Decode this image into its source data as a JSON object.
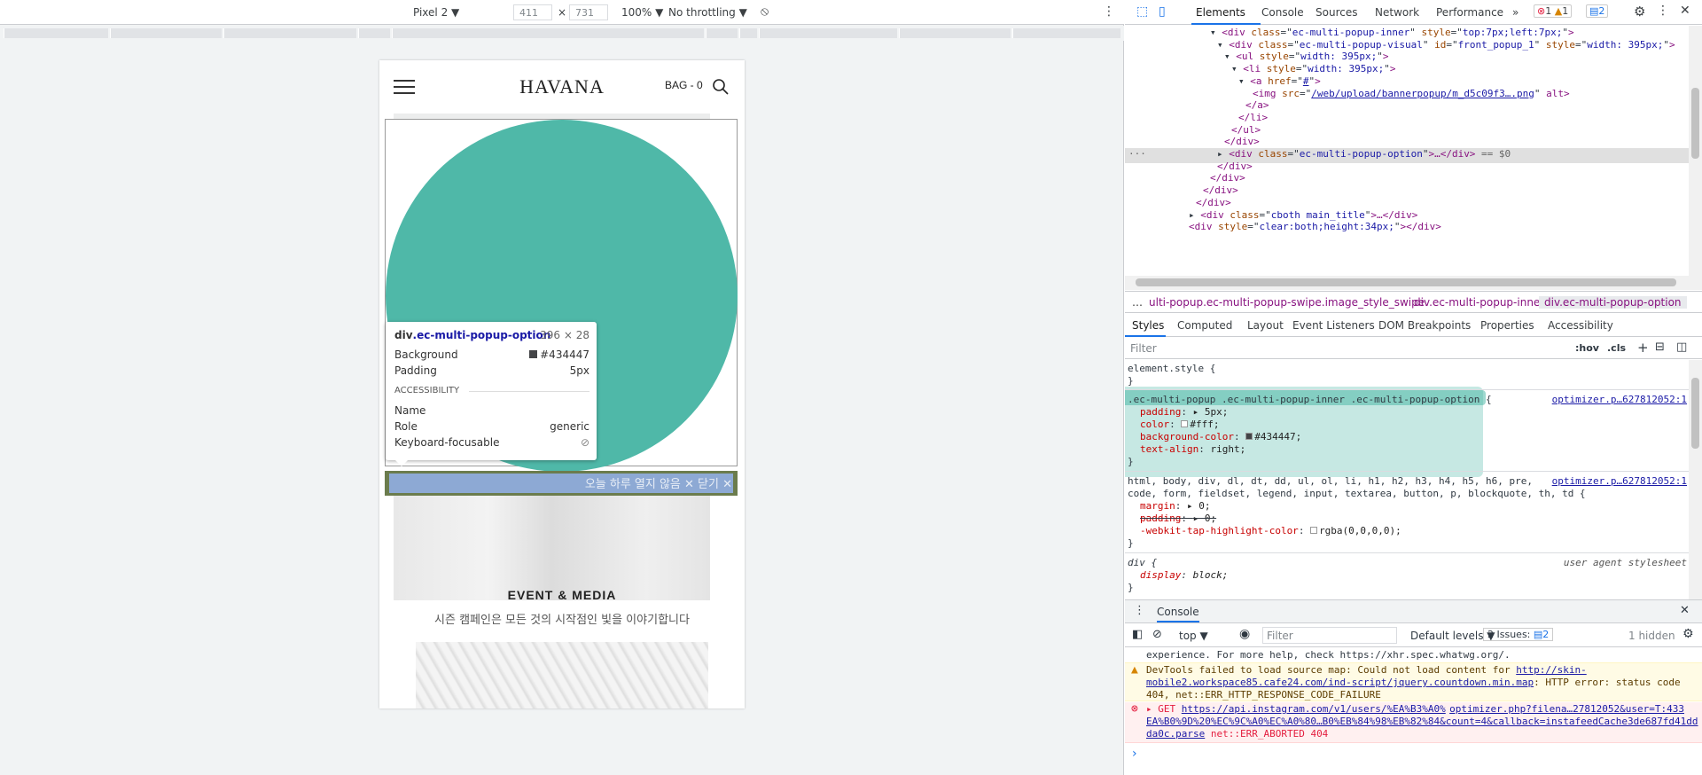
{
  "device_toolbar": {
    "device": "Pixel 2 ▼",
    "width": "411",
    "times": "×",
    "height": "731",
    "zoom": "100% ▼",
    "throttle": "No throttling ▼"
  },
  "site": {
    "logo": "HAVANA",
    "bag": "BAG - 0",
    "popup_option_text": "오늘 하루 열지 않음 ✕ 닫기 ✕",
    "event_title": "EVENT & MEDIA",
    "event_subtitle": "시즌 캠페인은 모든 것의 시작점인 빛을 이야기합니다",
    "popup_circle_color": "#4fb8a8"
  },
  "tooltip": {
    "element_tag": "div",
    "element_class": ".ec-multi-popup-option",
    "size": "396 × 28",
    "background_label": "Background",
    "background_value": "#434447",
    "padding_label": "Padding",
    "padding_value": "5px",
    "section": "ACCESSIBILITY",
    "name_label": "Name",
    "role_label": "Role",
    "role_value": "generic",
    "focus_label": "Keyboard-focusable"
  },
  "devtools": {
    "tabs": [
      "Elements",
      "Console",
      "Sources",
      "Network",
      "Performance",
      "»"
    ],
    "errors": "1",
    "warnings": "1",
    "messages": "2",
    "dom_lines": [
      {
        "indent": 11,
        "pre": "▾",
        "tag": "<div ",
        "attrs": [
          [
            "class",
            "ec-multi-popup-inner"
          ],
          [
            "style",
            "top:7px;left:7px;"
          ]
        ],
        "close": ">"
      },
      {
        "indent": 12,
        "pre": "▾",
        "tag": "<div ",
        "attrs": [
          [
            "class",
            "ec-multi-popup-visual"
          ],
          [
            "id",
            "front_popup_1"
          ],
          [
            "style",
            "width: 395px;"
          ]
        ],
        "close": ">"
      },
      {
        "indent": 13,
        "pre": "▾",
        "tag": "<ul ",
        "attrs": [
          [
            "style",
            "width: 395px;"
          ]
        ],
        "close": ">"
      },
      {
        "indent": 14,
        "pre": "▾",
        "tag": "<li ",
        "attrs": [
          [
            "style",
            "width: 395px;"
          ]
        ],
        "close": ">"
      },
      {
        "indent": 15,
        "pre": "▾",
        "tag": "<a ",
        "attrs": [
          [
            "href",
            "#"
          ]
        ],
        "close": ">"
      },
      {
        "indent": 17,
        "pre": "",
        "tag": "<img ",
        "attrs": [
          [
            "src",
            "/web/upload/bannerpopup/m_d5c09f3….png"
          ]
        ],
        "close": " alt>"
      },
      {
        "indent": 16,
        "pre": "",
        "tag": "</a>",
        "attrs": [],
        "close": ""
      },
      {
        "indent": 15,
        "pre": "",
        "tag": "</li>",
        "attrs": [],
        "close": ""
      },
      {
        "indent": 14,
        "pre": "",
        "tag": "</ul>",
        "attrs": [],
        "close": ""
      },
      {
        "indent": 13,
        "pre": "",
        "tag": "</div>",
        "attrs": [],
        "close": ""
      },
      {
        "indent": 12,
        "pre": "▸",
        "tag": "<div ",
        "attrs": [
          [
            "class",
            "ec-multi-popup-option"
          ]
        ],
        "close": ">…</div> == $0",
        "selected": true
      },
      {
        "indent": 12,
        "pre": "",
        "tag": "</div>",
        "attrs": [],
        "close": ""
      },
      {
        "indent": 11,
        "pre": "",
        "tag": "</div>",
        "attrs": [],
        "close": ""
      },
      {
        "indent": 10,
        "pre": "",
        "tag": "</div>",
        "attrs": [],
        "close": ""
      },
      {
        "indent": 9,
        "pre": "",
        "tag": "</div>",
        "attrs": [],
        "close": ""
      },
      {
        "indent": 8,
        "pre": "▸",
        "tag": "<div ",
        "attrs": [
          [
            "class",
            "cboth main_title"
          ]
        ],
        "close": ">…</div>"
      },
      {
        "indent": 8,
        "pre": "",
        "tag": "<div ",
        "attrs": [
          [
            "style",
            "clear:both;height:34px;"
          ]
        ],
        "close": "></div>"
      }
    ],
    "breadcrumbs": [
      "…",
      "ulti-popup.ec-multi-popup-swipe.image_style_swipe.",
      "div.ec-multi-popup-inner",
      "div.ec-multi-popup-option"
    ],
    "style_tabs": [
      "Styles",
      "Computed",
      "Layout",
      "Event Listeners",
      "DOM Breakpoints",
      "Properties",
      "Accessibility"
    ],
    "filter_placeholder": "Filter",
    "hov": ":hov",
    "cls": ".cls",
    "styles": {
      "element_style": "element.style {",
      "close": "}",
      "rule1_selector": ".ec-multi-popup .ec-multi-popup-inner .ec-multi-popup-option",
      "rule1_src": "optimizer.p…627812052:1",
      "rule1_props": [
        [
          "padding",
          "▸ 5px;"
        ],
        [
          "color",
          "#fff;"
        ],
        [
          "background-color",
          "#434447;"
        ],
        [
          "text-align",
          "right;"
        ]
      ],
      "rule2_selector1": "html, body, div, dl, dt, dd, ul, ol, li, h1, h2, h3, h4, h5, h6, pre,",
      "rule2_selector2": "code, form, fieldset, legend, input, textarea, button, p, blockquote, th, td {",
      "rule2_src": "optimizer.p…627812052:1",
      "rule2_props": [
        [
          "margin",
          "▸ 0;"
        ],
        [
          "padding",
          "▸ 0;"
        ],
        [
          "-webkit-tap-highlight-color",
          "rgba(0,0,0,0);"
        ]
      ],
      "rule3_selector": "div {",
      "rule3_src": "user agent stylesheet",
      "rule3_prop": "display",
      "rule3_value": "block;"
    },
    "console": {
      "title": "Console",
      "context": "top ▼",
      "filter_placeholder": "Filter",
      "levels": "Default levels ▼",
      "issues": "2 Issues:",
      "issues_count": "2",
      "hidden": "1 hidden",
      "line0": "experience. For more help, check https://xhr.spec.whatwg.org/.",
      "warn1": "DevTools failed to load source map: Could not load content for ",
      "warn_link": "http://skin-mobile2.workspace85.cafe24.com/ind-script/jquery.countdown.min.map",
      "warn2": ": HTTP error: status code 404, net::ERR_HTTP_RESPONSE_CODE_FAILURE",
      "err_method": "▸ GET ",
      "err_link": "https://api.instagram.com/v1/users/%EA%B3%A0%EA%B0%9D%20%EC%9C%A0%EC%A0%80…B0%EB%84%98%EB%82%84&count=4&callback=instafeedCache3de687fd41ddda0c.parse",
      "err_src": "optimizer.php?filena…27812052&user=T:433",
      "err_tail": " net::ERR_ABORTED 404",
      "prompt": "›"
    }
  }
}
